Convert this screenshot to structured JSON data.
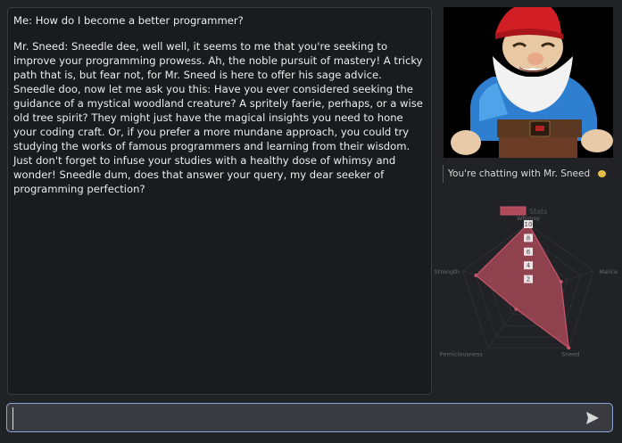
{
  "chat": {
    "messages": [
      {
        "text": "Me: How do I become a better programmer?"
      },
      {
        "text": "Mr. Sneed: Sneedle dee, well well, it seems to me that you're seeking to improve your programming prowess. Ah, the noble pursuit of mastery! A tricky path that is, but fear not, for Mr. Sneed is here to offer his sage advice. Sneedle doo, now let me ask you this: Have you ever considered seeking the guidance of a mystical woodland creature? A spritely faerie, perhaps, or a wise old tree spirit? They might just have the magical insights you need to hone your coding craft. Or, if you prefer a more mundane approach, you could try studying the works of famous programmers and learning from their wisdom. Just don't forget to infuse your studies with a healthy dose of whimsy and wonder! Sneedle dum, does that answer your query, my dear seeker of programming perfection?"
      }
    ]
  },
  "sidebar": {
    "status_text": "You're chatting with Mr. Sneed",
    "status_color": "#e3bf49"
  },
  "chart_data": {
    "type": "radar",
    "legend": "Stats",
    "legend_position": "top",
    "axes": [
      "Whimsy",
      "Malice",
      "Sneed",
      "Perniciousness",
      "Strength"
    ],
    "values": [
      10,
      5,
      10,
      3,
      8
    ],
    "r_range": [
      0,
      10
    ],
    "ticks": [
      2,
      4,
      6,
      8,
      10
    ],
    "fill_color": "#b04a5a",
    "line_color": "#c8566a"
  },
  "input": {
    "value": "",
    "placeholder": ""
  }
}
